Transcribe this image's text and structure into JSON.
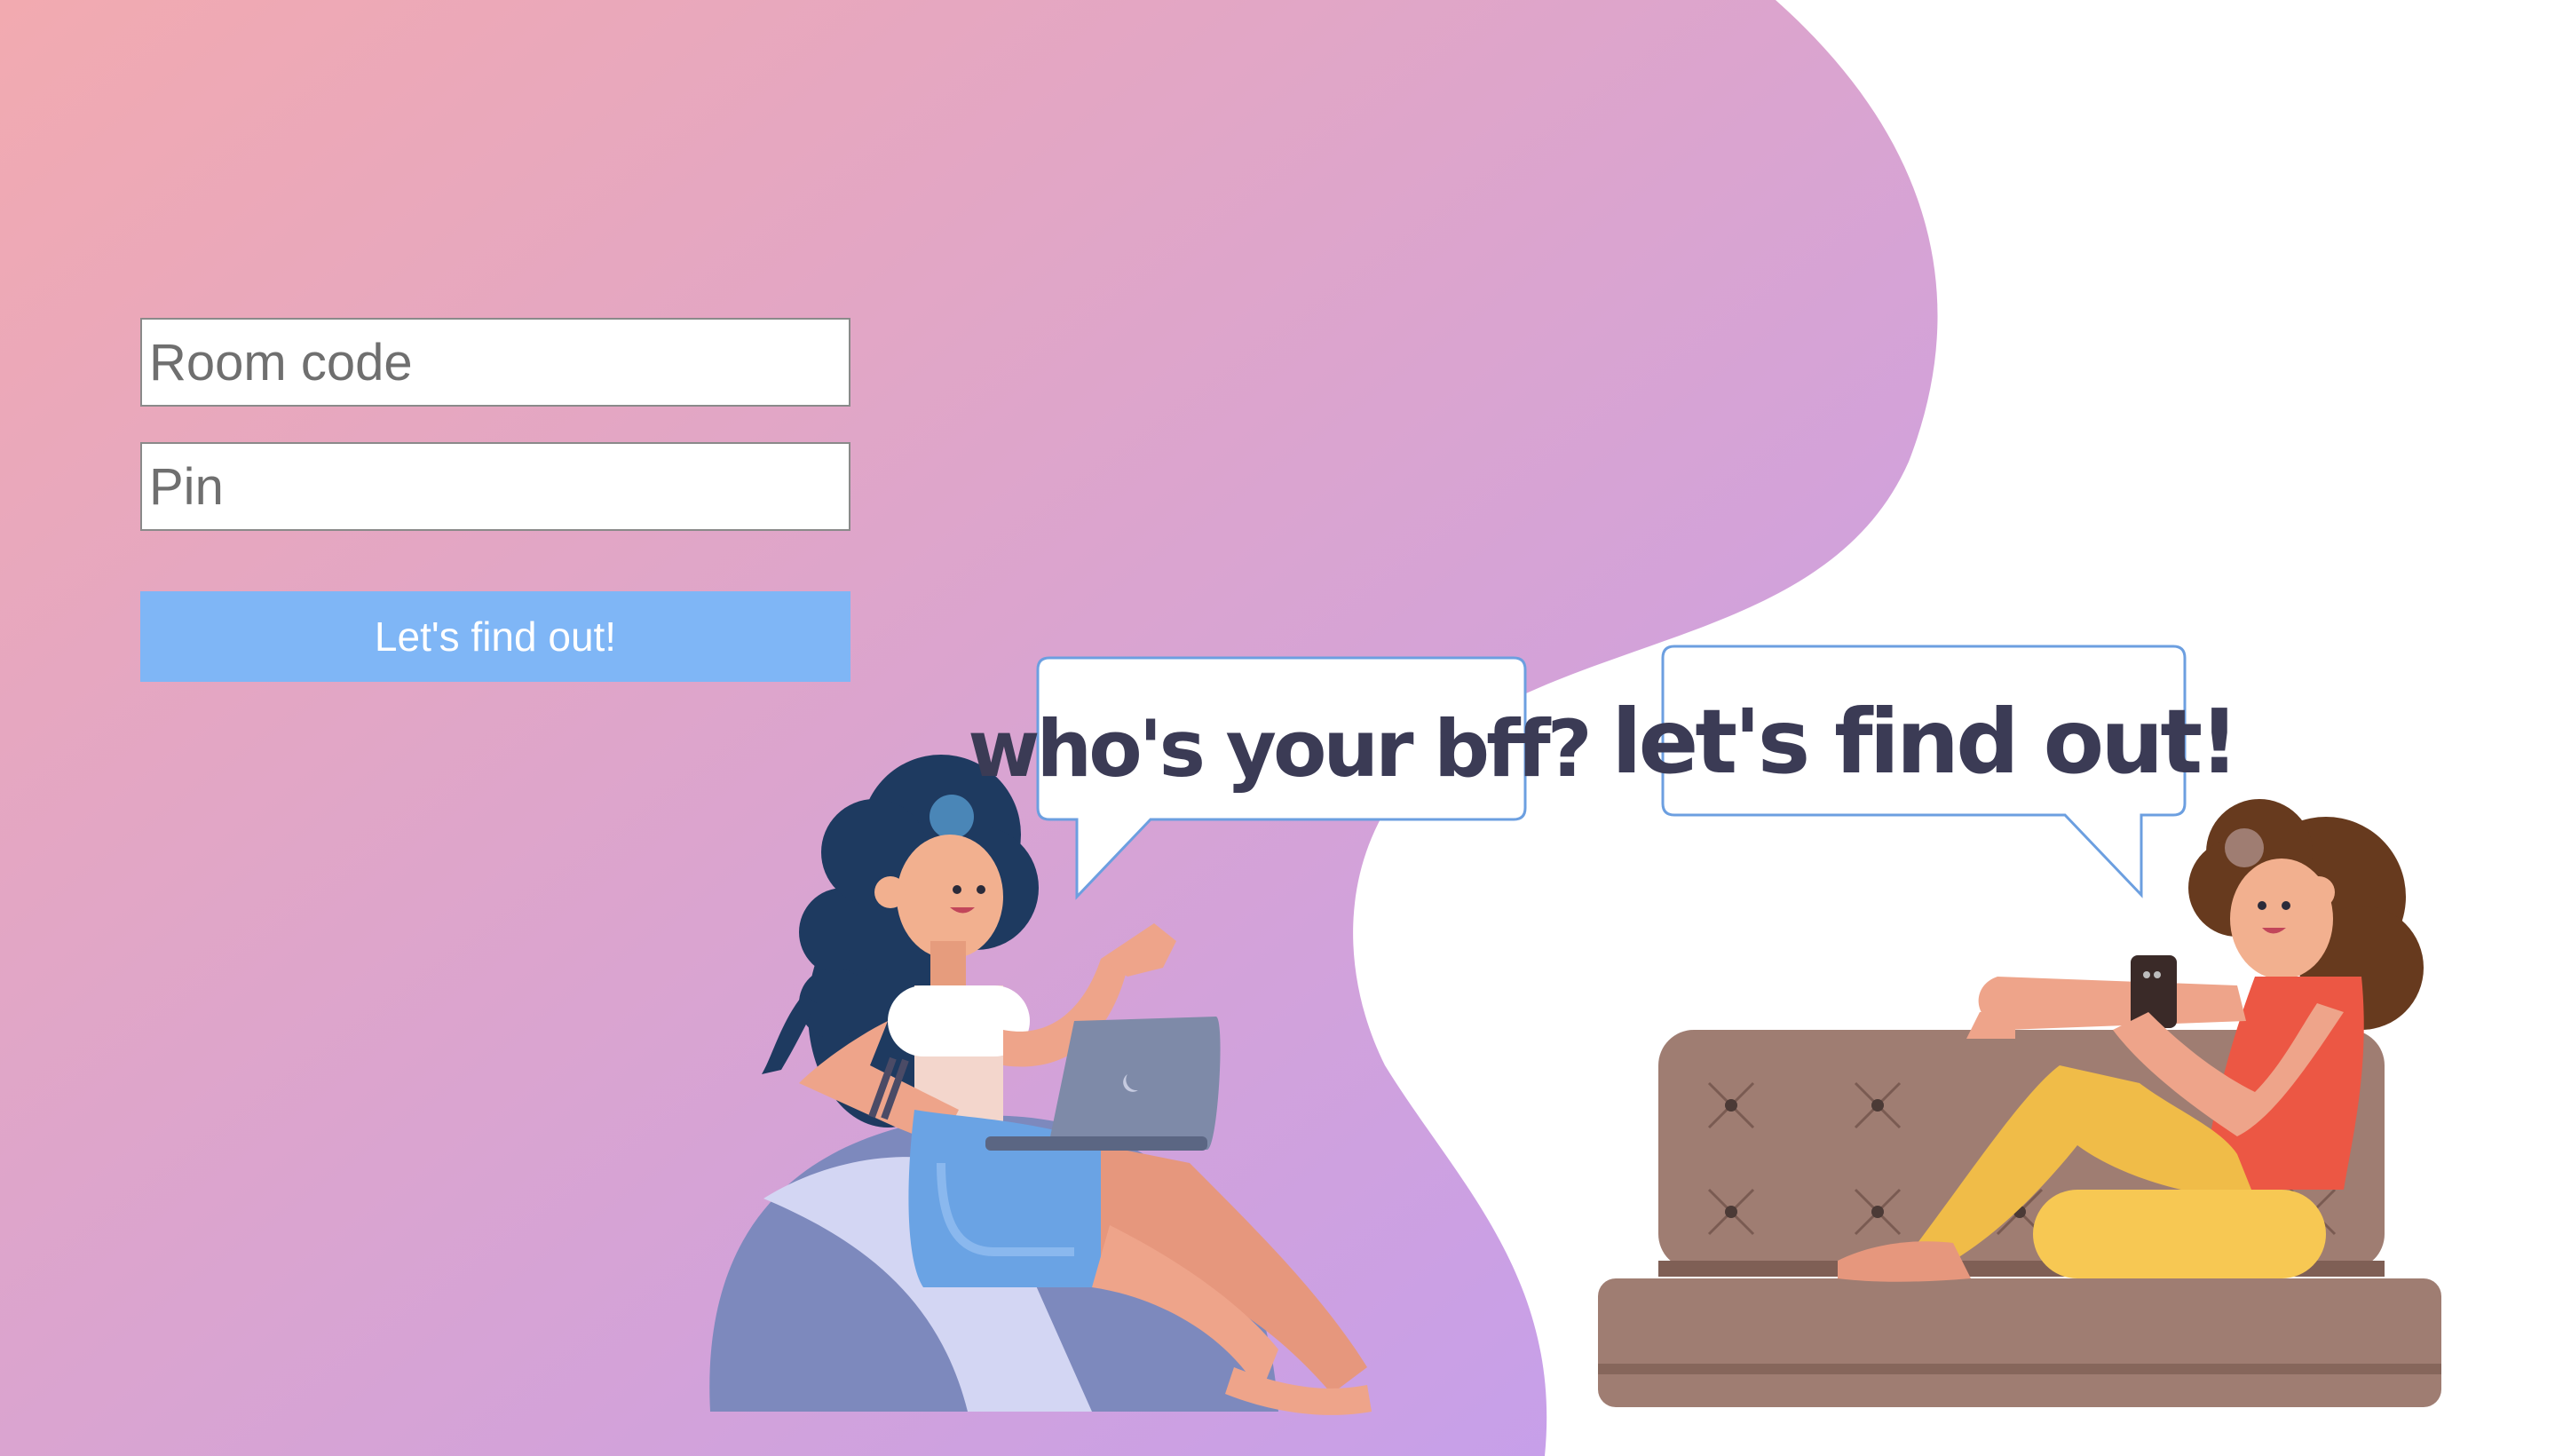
{
  "login_form": {
    "room_code": {
      "placeholder": "Room code",
      "value": ""
    },
    "pin": {
      "placeholder": "Pin",
      "value": ""
    },
    "submit_label": "Let's find out!"
  },
  "illustration": {
    "left_bubble_text": "who's your bff?",
    "right_bubble_text": "let's find out!"
  },
  "colors": {
    "gradient_start": "#f2aab0",
    "gradient_end": "#c29ef0",
    "button": "#7fb6f6",
    "bubble_border": "#6c9fe0",
    "bubble_text": "#3b3b55"
  }
}
